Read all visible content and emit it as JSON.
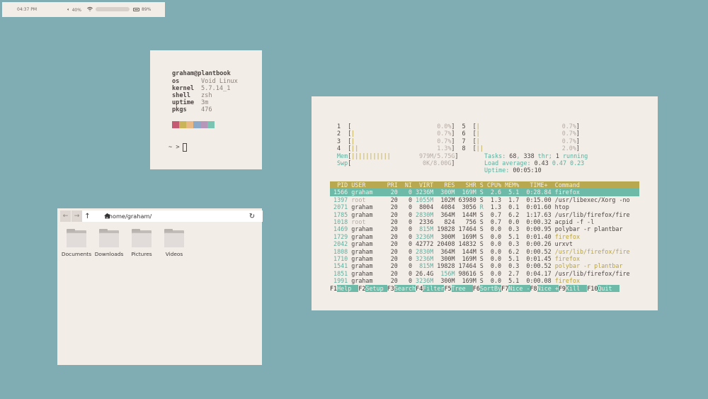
{
  "topbar": {
    "time": "04:37 PM",
    "volume": "40%",
    "wifi_name": "",
    "battery": "89%"
  },
  "neofetch": {
    "user_host": "graham@plantbook",
    "rows": [
      {
        "key": "os",
        "value": "Void Linux"
      },
      {
        "key": "kernel",
        "value": "5.7.14_1"
      },
      {
        "key": "shell",
        "value": "zsh"
      },
      {
        "key": "uptime",
        "value": "3m"
      },
      {
        "key": "pkgs",
        "value": "476"
      }
    ],
    "swatches": [
      "#c55a73",
      "#c9b45a",
      "#e9b985",
      "#8ca9c8",
      "#b797b9",
      "#7cc4b2"
    ],
    "prompt": "~ >"
  },
  "filemanager": {
    "path": "/home/graham/",
    "folders": [
      "Documents",
      "Downloads",
      "Pictures",
      "Videos"
    ]
  },
  "htop": {
    "cpu_lines": [
      "1  [                        0.0%]  5  [|                       0.7%]",
      "2  [|                       0.7%]  6  [|                       0.7%]",
      "3  [|                       0.7%]  7  [|                       0.7%]",
      "4  [||                      1.3%]  8  [||                      2.0%]"
    ],
    "mem_line": "Mem[|||||||||||        979M/5.75G]",
    "swp_line": "Swp[                    0K/8.00G]",
    "tasks_label": "Tasks: ",
    "tasks_value": "68",
    "thr_value": "338",
    "running_value": "1",
    "load_label": "Load average: ",
    "load_values": [
      "0.43",
      "0.47",
      "0.23"
    ],
    "uptime_label": "Uptime: ",
    "uptime_value": "00:05:10",
    "header": "  PID USER      PRI  NI  VIRT   RES   SHR S CPU% MEM%   TIME+  Command",
    "rows": [
      " 1566 graham     20   0 3236M  300M  169M S  2.6  5.1  0:28.84 firefox",
      " 1397 root       20   0 1055M  102M 63980 S  1.3  1.7  0:15.00 /usr/libexec/Xorg -no",
      " 2071 graham     20   0  8004  4084  3056 R  1.3  0.1  0:01.60 htop",
      " 1785 graham     20   0 2830M  364M  144M S  0.7  6.2  1:17.63 /usr/lib/firefox/fire",
      " 1018 root       20   0  2336   824   756 S  0.7  0.0  0:00.32 acpid -f -l",
      " 1469 graham     20   0  815M 19828 17464 S  0.0  0.3  0:00.95 polybar -r plantbar",
      " 1729 graham     20   0 3236M  300M  169M S  0.0  5.1  0:01.40 firefox",
      " 2042 graham     20   0 42772 20408 14832 S  0.0  0.3  0:00.26 urxvt",
      " 1808 graham     20   0 2830M  364M  144M S  0.0  6.2  0:00.52 /usr/lib/firefox/fire",
      " 1710 graham     20   0 3236M  300M  169M S  0.0  5.1  0:01.45 firefox",
      " 1541 graham     20   0  815M 19828 17464 S  0.0  0.3  0:00.52 polybar -r plantbar",
      " 1851 graham     20   0 26.4G  156M 98616 S  0.0  2.7  0:04.17 /usr/lib/firefox/fire",
      " 1991 graham     20   0 3236M  300M  169M S  0.0  5.1  0:00.08 firefox"
    ],
    "fkeys": [
      {
        "n": "F1",
        "label": "Help  "
      },
      {
        "n": "F2",
        "label": "Setup "
      },
      {
        "n": "F3",
        "label": "Search"
      },
      {
        "n": "F4",
        "label": "Filter"
      },
      {
        "n": "F5",
        "label": "Tree  "
      },
      {
        "n": "F6",
        "label": "SortBy"
      },
      {
        "n": "F7",
        "label": "Nice -"
      },
      {
        "n": "F8",
        "label": "Nice +"
      },
      {
        "n": "F9",
        "label": "Kill  "
      },
      {
        "n": "F10",
        "label": "Quit  "
      }
    ]
  }
}
